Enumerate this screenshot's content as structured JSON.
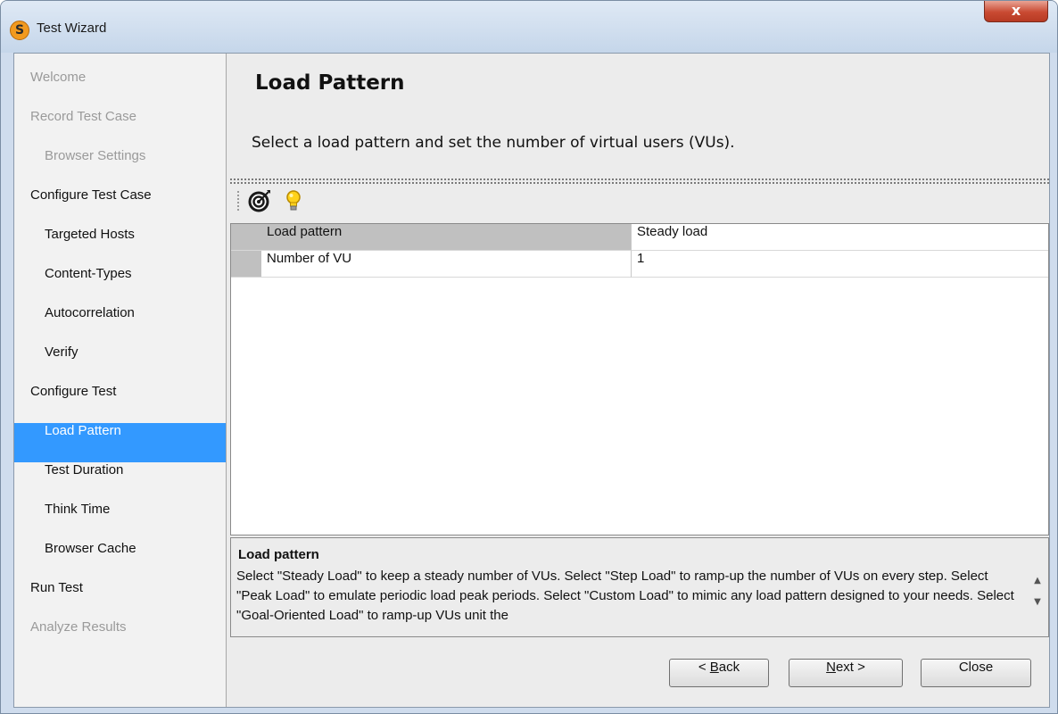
{
  "window": {
    "title": "Test Wizard",
    "app_icon_letter": "S",
    "close_symbol": "x"
  },
  "sidebar": {
    "items": [
      {
        "label": "Welcome",
        "state": "disabled",
        "indent": false
      },
      {
        "label": "Record Test Case",
        "state": "disabled",
        "indent": false
      },
      {
        "label": "Browser Settings",
        "state": "disabled",
        "indent": true
      },
      {
        "label": "Configure Test Case",
        "state": "normal",
        "indent": false
      },
      {
        "label": "Targeted Hosts",
        "state": "normal",
        "indent": true
      },
      {
        "label": "Content-Types",
        "state": "normal",
        "indent": true
      },
      {
        "label": "Autocorrelation",
        "state": "normal",
        "indent": true
      },
      {
        "label": "Verify",
        "state": "normal",
        "indent": true
      },
      {
        "label": "Configure Test",
        "state": "normal",
        "indent": false
      },
      {
        "label": "Load Pattern",
        "state": "selected",
        "indent": true
      },
      {
        "label": "Test Duration",
        "state": "normal",
        "indent": true
      },
      {
        "label": "Think Time",
        "state": "normal",
        "indent": true
      },
      {
        "label": "Browser Cache",
        "state": "normal",
        "indent": true
      },
      {
        "label": "Run Test",
        "state": "normal",
        "indent": false
      },
      {
        "label": "Analyze Results",
        "state": "disabled",
        "indent": false
      }
    ]
  },
  "main": {
    "title": "Load Pattern",
    "subtitle": "Select a load pattern and set the number of virtual users (VUs).",
    "toolbar": {
      "icons": [
        "target-icon",
        "lightbulb-icon"
      ]
    },
    "properties": [
      {
        "name": "Load pattern",
        "value": "Steady load"
      },
      {
        "name": "Number of VU",
        "value": "1"
      }
    ],
    "description": {
      "title": "Load pattern",
      "text": "Select \"Steady Load\" to keep a steady number of VUs. Select \"Step Load\" to ramp-up the number of VUs on every step. Select \"Peak Load\" to emulate periodic load peak periods. Select \"Custom Load\" to mimic any load pattern designed to your needs. Select \"Goal-Oriented Load\" to ramp-up VUs unit the"
    }
  },
  "buttons": {
    "back": {
      "prefix": "< ",
      "mnemonic": "B",
      "rest": "ack"
    },
    "next": {
      "mnemonic": "N",
      "rest": "ext >"
    },
    "close": "Close"
  },
  "colors": {
    "selection": "#3399ff",
    "title_bar": "#cfdced",
    "close_button": "#c94a32"
  }
}
